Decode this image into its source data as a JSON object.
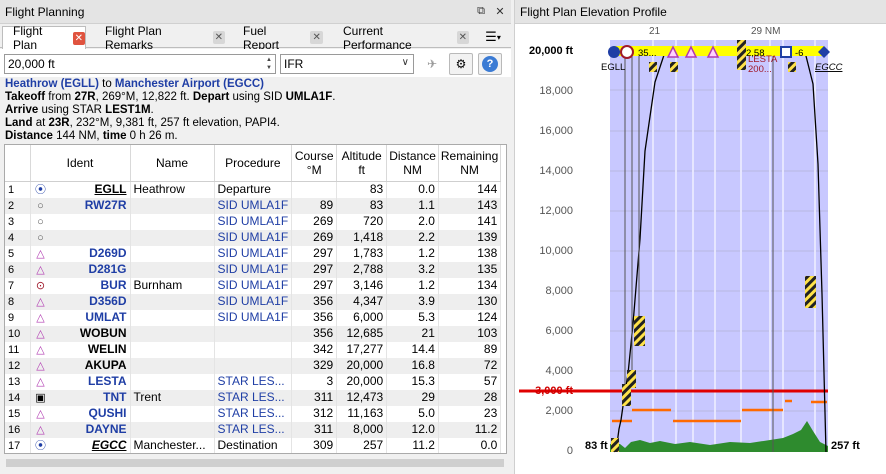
{
  "left_panel": {
    "title": "Flight Planning",
    "float_icon": "float-icon",
    "close_icon": "close-icon"
  },
  "tabs": [
    {
      "label": "Flight Plan",
      "active": true
    },
    {
      "label": "Flight Plan Remarks",
      "active": false
    },
    {
      "label": "Fuel Report",
      "active": false
    },
    {
      "label": "Current Performance",
      "active": false
    }
  ],
  "toolbar": {
    "altitude_value": "20,000 ft",
    "flight_rules_value": "IFR"
  },
  "summary": {
    "departure": "Heathrow (EGLL)",
    "to": "to",
    "destination": "Manchester Airport (EGCC)",
    "takeoff_label": "Takeoff",
    "takeoff_from": "from",
    "takeoff_rwy": "27R",
    "takeoff_detail": ", 269°M, 12,822 ft.",
    "depart_label": "Depart",
    "depart_using": "using SID",
    "sid": "UMLA1F",
    "arrive_label": "Arrive",
    "arrive_using": "using STAR",
    "star": "LEST1M",
    "land_label": "Land",
    "land_at": "at",
    "land_rwy": "23R",
    "land_detail": ", 232°M, 9,381 ft, 257 ft elevation, PAPI4.",
    "distance_label": "Distance",
    "distance_value": "144 NM,",
    "time_label": "time",
    "time_value": "0 h 26 m."
  },
  "table": {
    "columns": [
      "",
      "Ident",
      "Name",
      "Procedure",
      "Course\n°M",
      "Altitude\nft",
      "Distance\nNM",
      "Remaining\nNM"
    ],
    "rows": [
      {
        "n": "1",
        "sym": "vor",
        "ident": "EGLL",
        "dec": "u",
        "name": "Heathrow",
        "proc": "Departure",
        "course": "",
        "alt": "83",
        "dist": "0.0",
        "rem": "144"
      },
      {
        "n": "2",
        "sym": "user",
        "ident": "RW27R",
        "dec": "",
        "name": "",
        "proc": "SID UMLA1F",
        "course": "89",
        "alt": "83",
        "dist": "1.1",
        "rem": "143"
      },
      {
        "n": "3",
        "sym": "user",
        "ident": "",
        "dec": "",
        "name": "",
        "proc": "SID UMLA1F",
        "course": "269",
        "alt": "720",
        "dist": "2.0",
        "rem": "141"
      },
      {
        "n": "4",
        "sym": "user",
        "ident": "",
        "dec": "",
        "name": "",
        "proc": "SID UMLA1F",
        "course": "269",
        "alt": "1,418",
        "dist": "2.2",
        "rem": "139"
      },
      {
        "n": "5",
        "sym": "wpt",
        "ident": "D269D",
        "dec": "",
        "name": "",
        "proc": "SID UMLA1F",
        "course": "297",
        "alt": "1,783",
        "dist": "1.2",
        "rem": "138"
      },
      {
        "n": "6",
        "sym": "wpt",
        "ident": "D281G",
        "dec": "",
        "name": "",
        "proc": "SID UMLA1F",
        "course": "297",
        "alt": "2,788",
        "dist": "3.2",
        "rem": "135"
      },
      {
        "n": "7",
        "sym": "ndb",
        "ident": "BUR",
        "dec": "",
        "name": "Burnham",
        "proc": "SID UMLA1F",
        "course": "297",
        "alt": "3,146",
        "rem": "134",
        "dist": "1.2"
      },
      {
        "n": "8",
        "sym": "wpt",
        "ident": "D356D",
        "dec": "",
        "name": "",
        "proc": "SID UMLA1F",
        "course": "356",
        "alt": "4,347",
        "dist": "3.9",
        "rem": "130"
      },
      {
        "n": "9",
        "sym": "wpt",
        "ident": "UMLAT",
        "dec": "",
        "name": "",
        "proc": "SID UMLA1F",
        "course": "356",
        "alt": "6,000",
        "dist": "5.3",
        "rem": "124"
      },
      {
        "n": "10",
        "sym": "wpt",
        "ident": "WOBUN",
        "dec": "",
        "name": "",
        "proc": "",
        "course": "356",
        "alt": "12,685",
        "dist": "21",
        "rem": "103"
      },
      {
        "n": "11",
        "sym": "wpt",
        "ident": "WELIN",
        "dec": "",
        "name": "",
        "proc": "",
        "course": "342",
        "alt": "17,277",
        "dist": "14.4",
        "rem": "89"
      },
      {
        "n": "12",
        "sym": "wpt",
        "ident": "AKUPA",
        "dec": "",
        "name": "",
        "proc": "",
        "course": "329",
        "alt": "20,000",
        "dist": "16.8",
        "rem": "72"
      },
      {
        "n": "13",
        "sym": "wpt",
        "ident": "LESTA",
        "dec": "",
        "name": "",
        "proc": "STAR LES...",
        "course": "3",
        "alt": "20,000",
        "dist": "15.3",
        "rem": "57"
      },
      {
        "n": "14",
        "sym": "vortac",
        "ident": "TNT",
        "dec": "",
        "name": "Trent",
        "proc": "STAR LES...",
        "course": "311",
        "alt": "12,473",
        "dist": "29",
        "rem": "28"
      },
      {
        "n": "15",
        "sym": "wpt",
        "ident": "QUSHI",
        "dec": "",
        "name": "",
        "proc": "STAR LES...",
        "course": "312",
        "alt": "11,163",
        "dist": "5.0",
        "rem": "23"
      },
      {
        "n": "16",
        "sym": "wpt",
        "ident": "DAYNE",
        "dec": "",
        "name": "",
        "proc": "STAR LES...",
        "course": "311",
        "alt": "8,000",
        "dist": "12.0",
        "rem": "11.2"
      },
      {
        "n": "17",
        "sym": "vor",
        "ident": "EGCC",
        "dec": "ui",
        "name": "Manchester...",
        "proc": "Destination",
        "course": "309",
        "alt": "257",
        "dist": "11.2",
        "rem": "0.0"
      }
    ]
  },
  "right_panel": {
    "title": "Flight Plan Elevation Profile"
  },
  "profile": {
    "y_ticks": [
      "20,000 ft",
      "18,000",
      "16,000",
      "14,000",
      "12,000",
      "10,000",
      "8,000",
      "6,000",
      "4,000",
      "3,000 ft",
      "2,000",
      "0"
    ],
    "top_labels": [
      "21",
      "29 NM"
    ],
    "left_alt_label": "83 ft",
    "right_alt_label": "257 ft",
    "waypoint_labels": [
      "EGLL",
      "LESTA",
      "200...",
      "EGCC",
      "35...",
      "2,58",
      "-6"
    ],
    "colors": {
      "sky": "#c8c8ff",
      "terrain": "#2e8b2e",
      "safe_alt": "#e00000",
      "route": "#ffff00",
      "leg_alt": "#ff6a00"
    }
  }
}
